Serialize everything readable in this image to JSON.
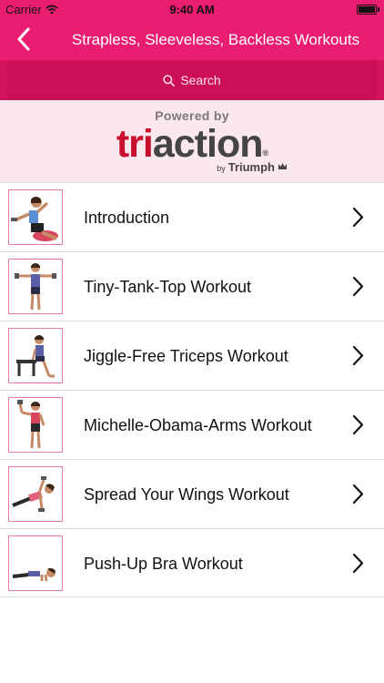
{
  "status_bar": {
    "carrier": "Carrier",
    "time": "9:40 AM"
  },
  "nav": {
    "title": "Strapless, Sleeveless, Backless Workouts"
  },
  "search": {
    "label": "Search"
  },
  "banner": {
    "powered_by": "Powered by",
    "logo_tri": "tri",
    "logo_action": "action",
    "logo_reg": "®",
    "by": "by",
    "brand": "Triumph"
  },
  "workouts": [
    {
      "title": "Introduction"
    },
    {
      "title": "Tiny-Tank-Top Workout"
    },
    {
      "title": "Jiggle-Free Triceps Workout"
    },
    {
      "title": "Michelle-Obama-Arms Workout"
    },
    {
      "title": "Spread Your Wings Workout"
    },
    {
      "title": "Push-Up Bra Workout"
    }
  ],
  "colors": {
    "accent": "#e91e71",
    "search_bg": "#cc1058",
    "banner_bg": "#fbe7ee",
    "logo_red": "#c8102e"
  }
}
